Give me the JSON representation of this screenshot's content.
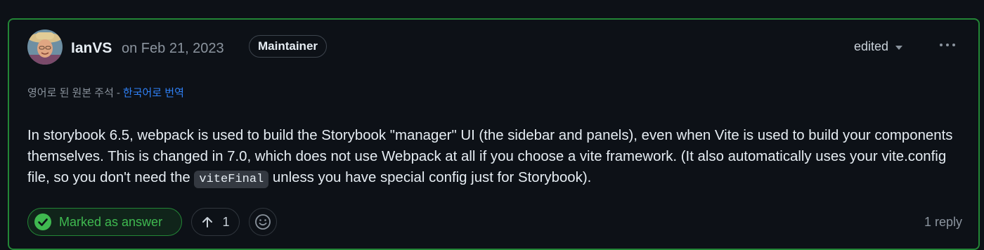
{
  "comment": {
    "author": "IanVS",
    "date": "on Feb 21, 2023",
    "role_badge": "Maintainer",
    "edited_label": "edited",
    "more_icon": "kebab-horizontal-icon",
    "translation": {
      "original_note": "영어로 된 원본 주석",
      "separator": "-",
      "translate_link": "한국어로 번역"
    },
    "body": {
      "part1": "In storybook 6.5, webpack is used to build the Storybook \"manager\" UI (the sidebar and panels), even when Vite is used to build your components themselves. This is changed in 7.0, which does not use Webpack at all if you choose a vite framework. (It also automatically uses your vite.config file, so you don't need the ",
      "code": "viteFinal",
      "part2": " unless you have special config just for Storybook)."
    },
    "footer": {
      "answer_label": "Marked as answer",
      "upvote_count": "1",
      "reply_count": "1 reply"
    }
  },
  "colors": {
    "accent_green": "#238636",
    "answer_text": "#3fb950",
    "link_blue": "#2f81f7",
    "background": "#0d1117"
  }
}
